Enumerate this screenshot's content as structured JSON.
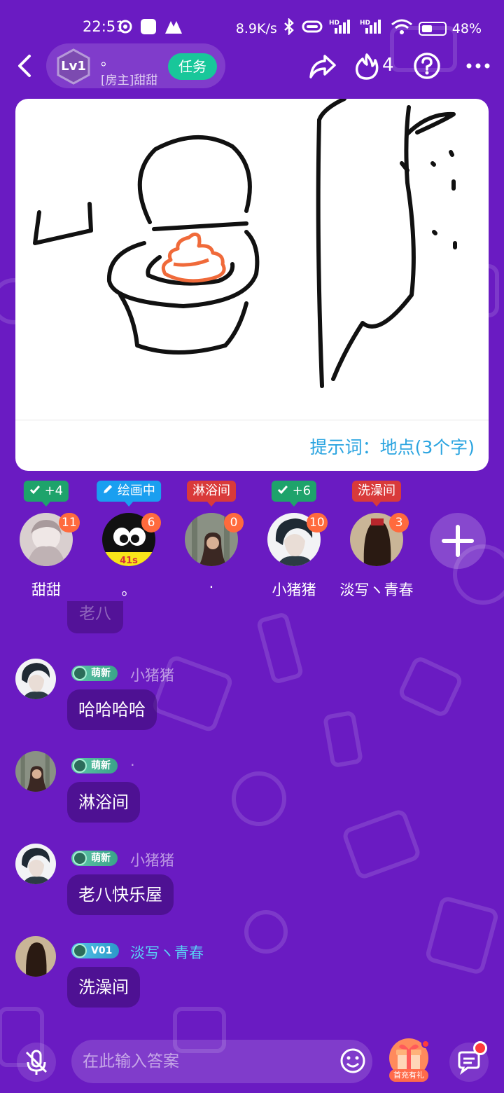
{
  "status_bar": {
    "time": "22:51",
    "net_speed": "8.9K/s",
    "battery": "48%",
    "battery_level": 0.48,
    "icons": [
      "weather-icon",
      "notification-icon",
      "app-icon",
      "bluetooth-icon",
      "vibrate-icon",
      "signal-hd-icon",
      "signal-hd-icon",
      "wifi-icon",
      "battery-icon"
    ]
  },
  "header": {
    "level": "Lv1",
    "room_name": "。",
    "host": "[房主]甜甜",
    "task_label": "任务",
    "fire_count": "4"
  },
  "canvas": {
    "hint": "提示词：地点(3个字)"
  },
  "players": [
    {
      "name": "甜甜",
      "count": "11",
      "tag": "+4",
      "tag_type": "check",
      "tag_color": "#1ea36b"
    },
    {
      "name": "。",
      "count": "6",
      "tag": "绘画中",
      "tag_type": "pencil",
      "tag_color": "#1a9ff0",
      "timer": "41s"
    },
    {
      "name": "·",
      "count": "0",
      "tag": "淋浴间",
      "tag_type": "text",
      "tag_color": "#d93a3a"
    },
    {
      "name": "小猪猪",
      "count": "10",
      "tag": "+6",
      "tag_type": "check",
      "tag_color": "#1ea36b"
    },
    {
      "name": "淡写ヽ青春",
      "count": "3",
      "tag": "洗澡间",
      "tag_type": "text",
      "tag_color": "#d93a3a"
    }
  ],
  "chat": {
    "partial": "老八",
    "messages": [
      {
        "badge": "萌新",
        "user": "小猪猪",
        "text": "哈哈哈哈",
        "vip": false
      },
      {
        "badge": "萌新",
        "user": "·",
        "text": "淋浴间",
        "vip": false
      },
      {
        "badge": "萌新",
        "user": "小猪猪",
        "text": "老八快乐屋",
        "vip": false
      },
      {
        "badge": "V01",
        "user": "淡写ヽ青春",
        "text": "洗澡间",
        "vip": true
      }
    ]
  },
  "bottom": {
    "placeholder": "在此输入答案",
    "gift_label": "首充有礼"
  }
}
